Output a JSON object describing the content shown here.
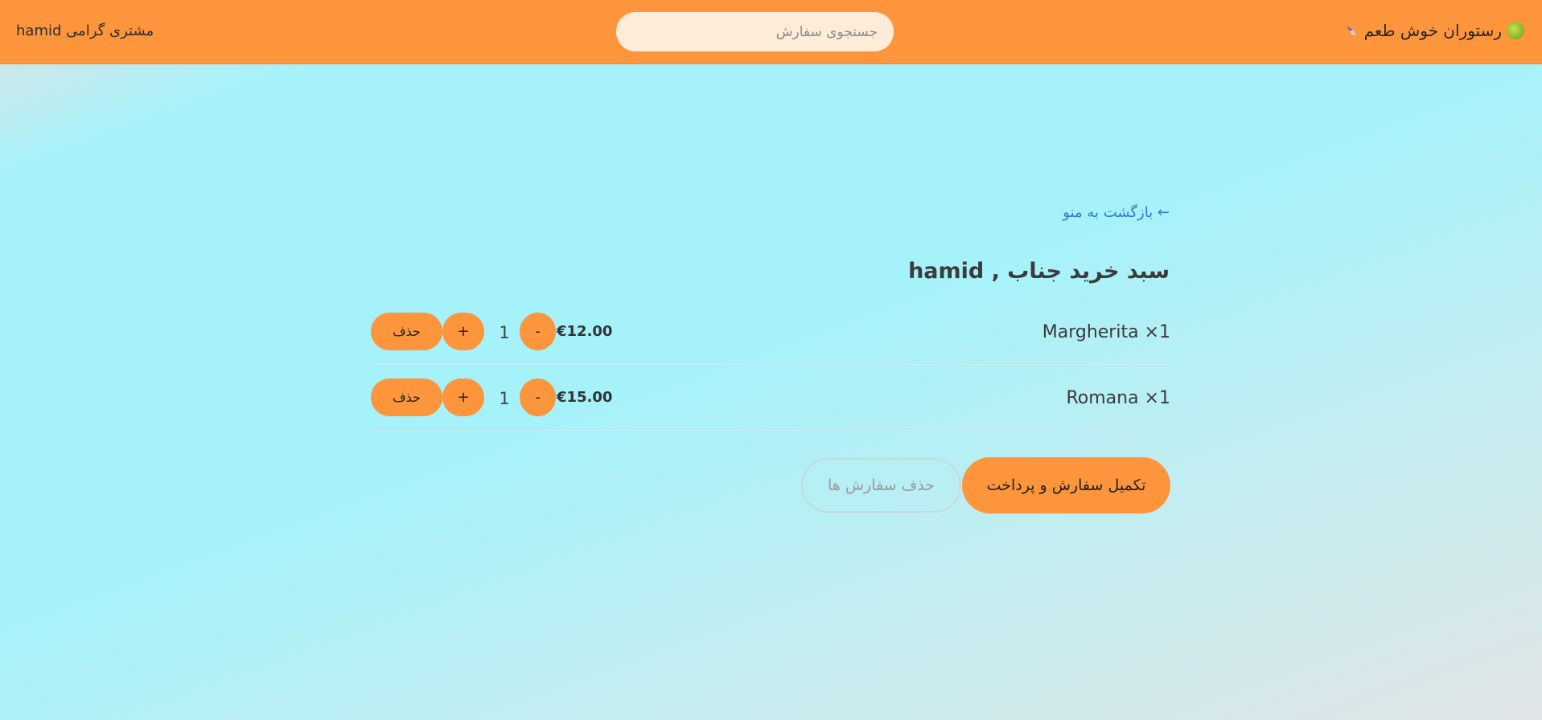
{
  "header": {
    "brand_name": "رستوران خوش طعم",
    "brand_icon": "food-icon",
    "search_placeholder": "جستجوی سفارش",
    "greeting": "مشتری گرامی hamid"
  },
  "cart": {
    "back_link": "← بازگشت به منو",
    "title": "سبد خرید جناب , hamid",
    "items": [
      {
        "name": "Margherita ×1",
        "price": "€12.00",
        "quantity": "1",
        "minus": "-",
        "plus": "+",
        "delete": "حذف"
      },
      {
        "name": "Romana ×1",
        "price": "€15.00",
        "quantity": "1",
        "minus": "-",
        "plus": "+",
        "delete": "حذف"
      }
    ],
    "checkout_label": "تکمیل سفارش و پرداخت",
    "clear_label": "حذف سفارش ها"
  },
  "colors": {
    "header_bg": "#fd953c",
    "accent": "#fd953c",
    "link": "#2f7bd8"
  }
}
